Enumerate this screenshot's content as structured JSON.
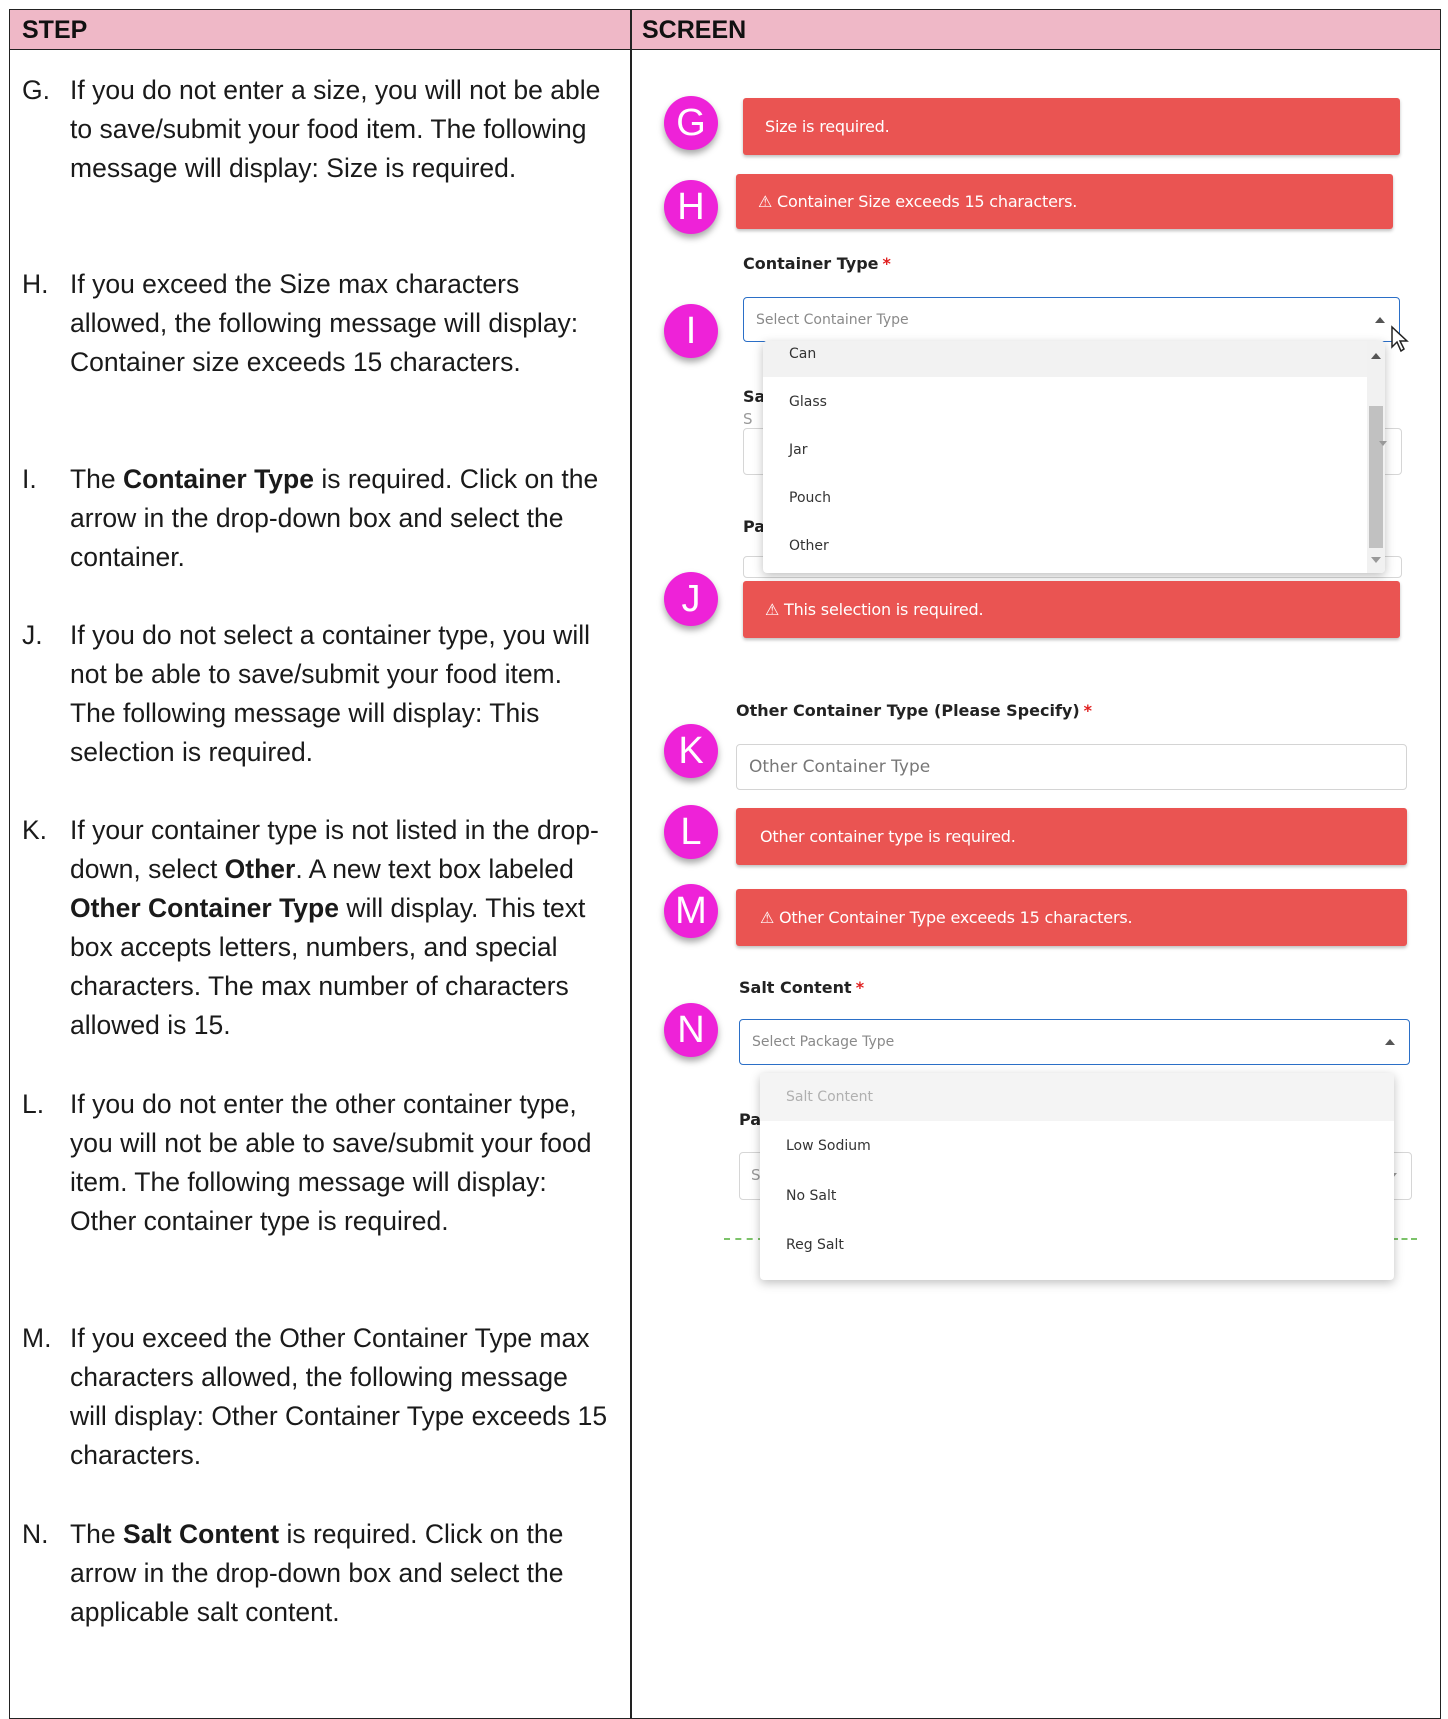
{
  "header": {
    "step": "STEP",
    "screen": "SCREEN"
  },
  "steps": {
    "g": {
      "letter": "G.",
      "text": "If you do not enter a size, you will not be able to save/submit your food item.  The following message will display:  Size is required."
    },
    "h": {
      "letter": "H.",
      "text": "If you exceed the Size max characters allowed, the following message will display:  Container size exceeds 15 characters."
    },
    "i": {
      "letter": "I.",
      "pre": "The ",
      "bold": "Container Type",
      "post": " is required. Click on the arrow in the drop-down box and select the container."
    },
    "j": {
      "letter": "J.",
      "text": "If you do not select a container type, you will not be able to save/submit your food item. The following message will display:  This selection is required."
    },
    "k": {
      "letter": "K.",
      "t1": "If your container type is not listed in the drop-down, select ",
      "b1": "Other",
      "t2": ".  A new text box labeled ",
      "b2": "Other Container Type",
      "t3": " will display.  This text box accepts letters, numbers, and special characters.  The max number of characters allowed is 15."
    },
    "l": {
      "letter": "L.",
      "text": "If you do not enter the other container type, you will not be able to save/submit your food item. The following message will display:  Other container type is required."
    },
    "m": {
      "letter": "M.",
      "text": "If you exceed the Other Container Type max characters allowed, the following message will display:  Other Container Type exceeds 15 characters."
    },
    "n": {
      "letter": "N.",
      "pre": "The ",
      "bold": "Salt Content",
      "post": " is required.  Click on the arrow in the drop-down box and select the applicable salt content."
    }
  },
  "screen": {
    "badges": {
      "g": "G",
      "h": "H",
      "i": "I",
      "j": "J",
      "k": "K",
      "l": "L",
      "m": "M",
      "n": "N"
    },
    "err_size_required": "Size is required.",
    "err_container_size": "⚠ Container Size exceeds 15 characters.",
    "container_type_label": "Container Type",
    "required_mark": "*",
    "container_type_placeholder": "Select Container Type",
    "container_options": [
      "Can",
      "Glass",
      "Jar",
      "Pouch",
      "Other"
    ],
    "partial_label_sa": "Sa",
    "partial_label_pa": "Pa",
    "partial_s": "S",
    "err_selection_required": "⚠ This selection is required.",
    "other_container_label": "Other Container Type (Please Specify)",
    "other_container_placeholder": "Other Container Type",
    "err_other_required": "Other container type is required.",
    "err_other_exceeds": "⚠ Other Container Type exceeds 15 characters.",
    "salt_label": "Salt Content",
    "salt_placeholder": "Select Package Type",
    "salt_options": [
      "Salt Content",
      "Low Sodium",
      "No Salt",
      "Reg Salt"
    ]
  },
  "colors": {
    "header_bg": "#efb8c7",
    "badge": "#ee22d8",
    "error": "#ea5452",
    "focus_border": "#2b6fc7"
  }
}
